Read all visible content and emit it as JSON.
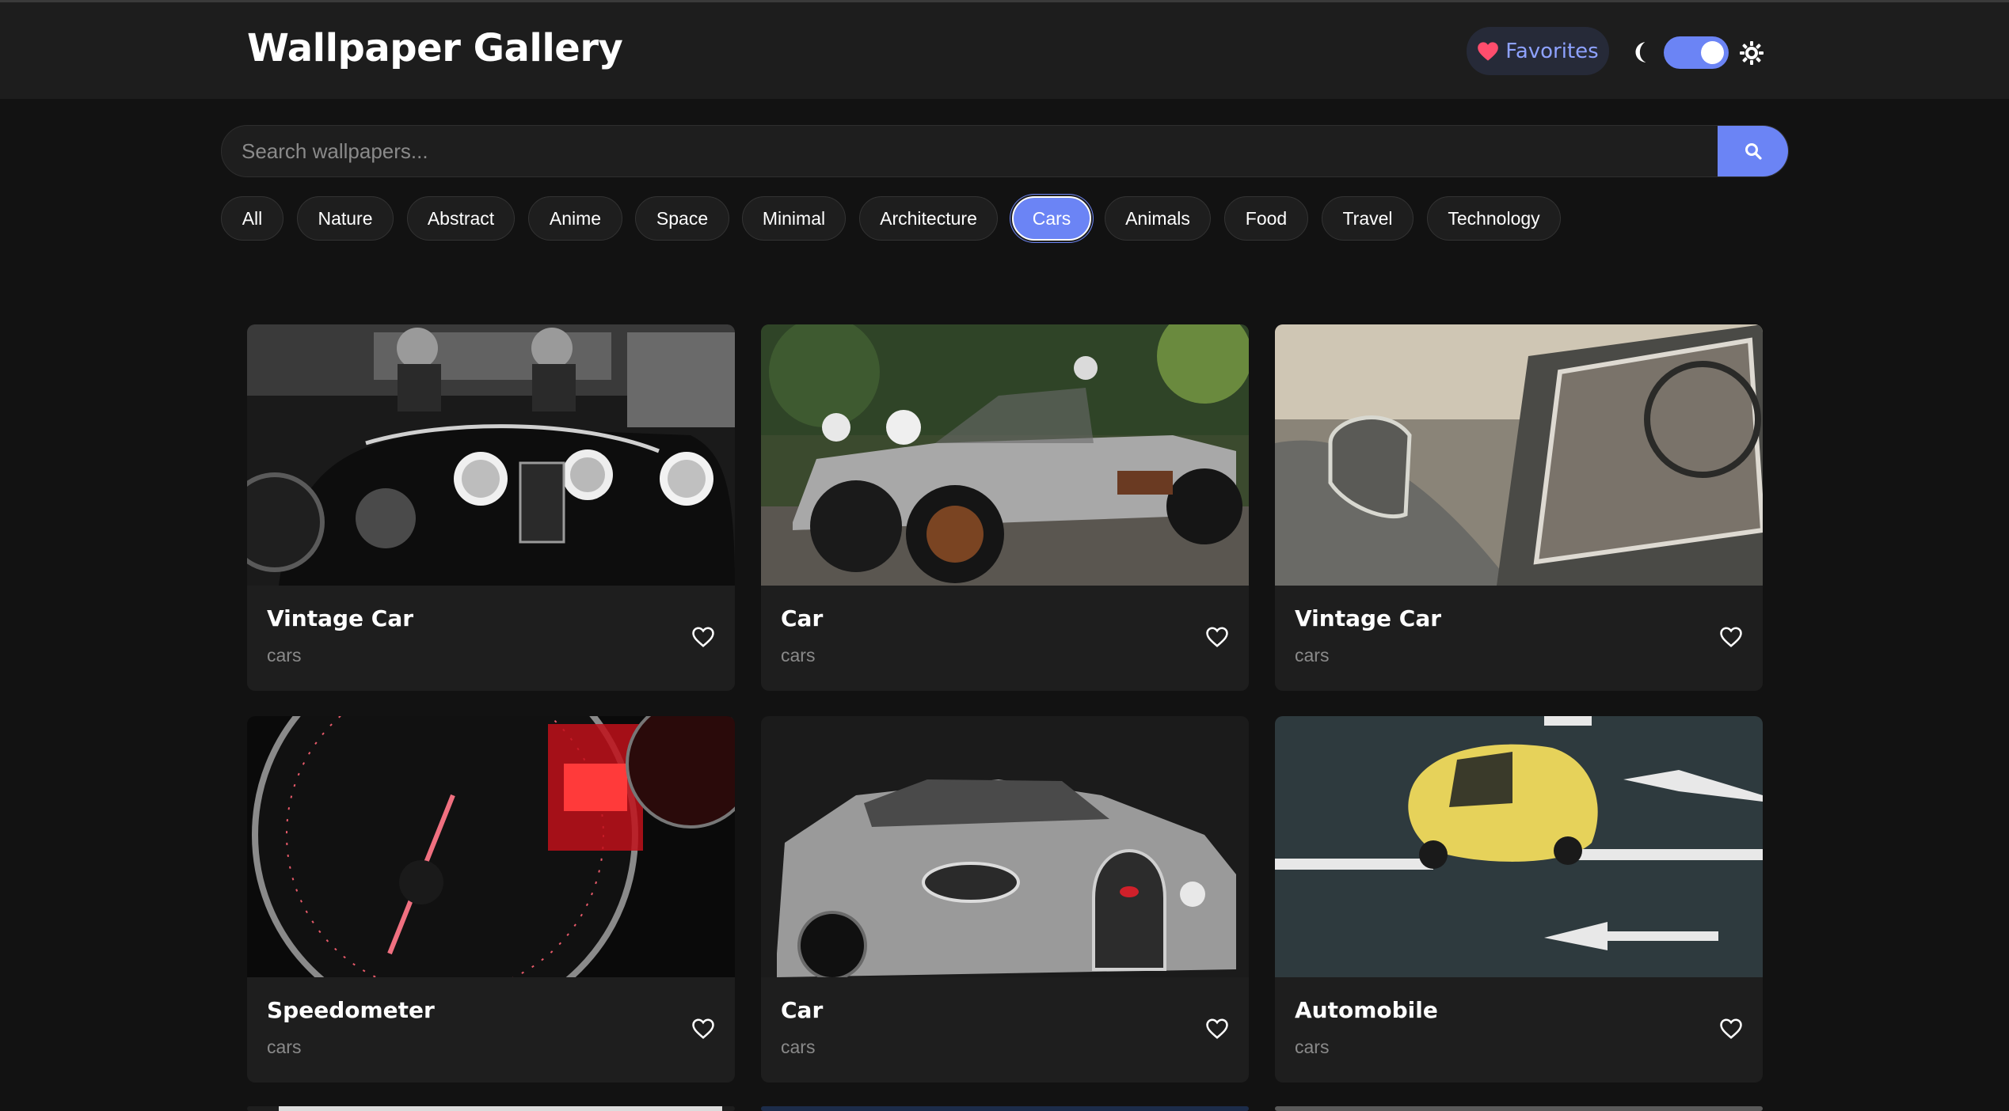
{
  "header": {
    "title": "Wallpaper Gallery",
    "favorites_label": "Favorites",
    "theme_toggle_on": true
  },
  "search": {
    "placeholder": "Search wallpapers...",
    "value": ""
  },
  "categories": {
    "items": [
      "All",
      "Nature",
      "Abstract",
      "Anime",
      "Space",
      "Minimal",
      "Architecture",
      "Cars",
      "Animals",
      "Food",
      "Travel",
      "Technology"
    ],
    "selected": "Cars"
  },
  "wallpapers": [
    {
      "title": "Vintage Car",
      "category": "cars"
    },
    {
      "title": "Car",
      "category": "cars"
    },
    {
      "title": "Vintage Car",
      "category": "cars"
    },
    {
      "title": "Speedometer",
      "category": "cars"
    },
    {
      "title": "Car",
      "category": "cars"
    },
    {
      "title": "Automobile",
      "category": "cars"
    }
  ],
  "colors": {
    "accent": "#6b84f5",
    "favorites_text": "#8ea2ff",
    "heart": "#ff4d6d",
    "background": "#121212",
    "surface": "#1e1e1e"
  },
  "icons": {
    "favorites": "heart-icon",
    "dark_mode": "moon-icon",
    "light_mode": "sun-icon",
    "search": "search-icon",
    "favorite_toggle": "heart-outline-icon"
  }
}
